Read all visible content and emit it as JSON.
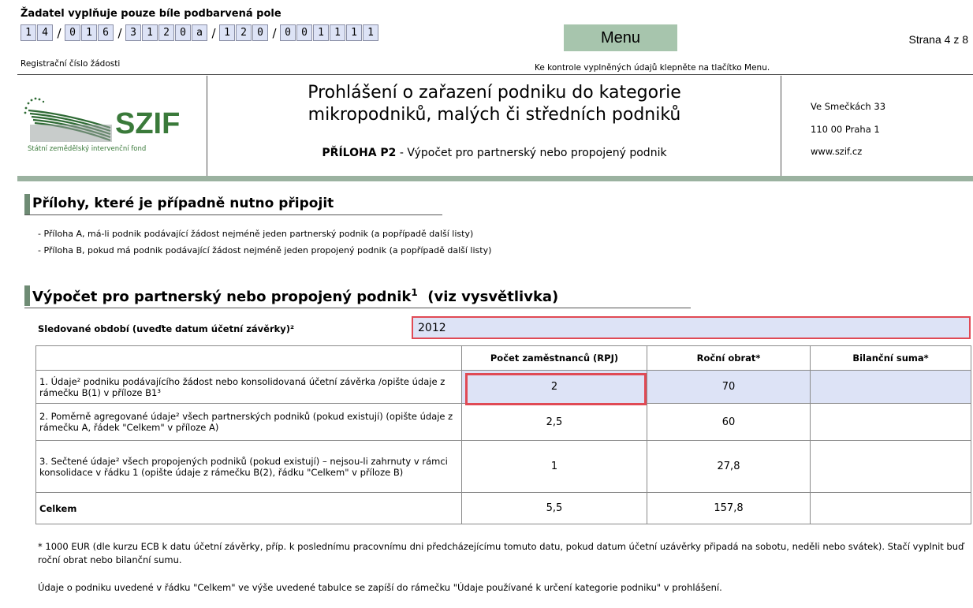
{
  "header": {
    "instruction": "Žadatel vyplňuje pouze bíle podbarvená pole",
    "reg_groups": [
      [
        "1",
        "4"
      ],
      [
        "0",
        "1",
        "6"
      ],
      [
        "3",
        "1",
        "2",
        "0",
        "a"
      ],
      [
        "1",
        "2",
        "0"
      ],
      [
        "0",
        "0",
        "1",
        "1",
        "1",
        "1"
      ]
    ],
    "reg_caption": "Registrační číslo žádosti",
    "menu_label": "Menu",
    "page_indicator": "Strana 4 z 8",
    "menu_hint": "Ke kontrole vyplněných údajů klepněte na tlačítko Menu."
  },
  "logo": {
    "name": "SZIF",
    "subtitle": "Státní zemědělský intervenční fond"
  },
  "title": {
    "line1": "Prohlášení o zařazení podniku do kategorie",
    "line2": "mikropodniků, malých či středních podniků",
    "annex_bold": "PŘÍLOHA P2",
    "annex_rest": " - Výpočet pro partnerský nebo propojený podnik"
  },
  "address": {
    "street": "Ve Smečkách 33",
    "city": "110 00 Praha 1",
    "web": "www.szif.cz"
  },
  "attachments": {
    "heading": "Přílohy, které je případně nutno připojit",
    "items": [
      "- Příloha A, má-li podnik podávající žádost nejméně jeden partnerský podnik (a popřípadě další listy)",
      "- Příloha B, pokud má podnik podávající žádost nejméně jeden propojený podnik (a popřípadě další listy)"
    ]
  },
  "calculation": {
    "heading": "Výpočet pro partnerský nebo propojený podnik",
    "heading_sup": "1",
    "heading_suffix": "(viz vysvětlivka)",
    "period_label": "Sledované období (uveďte datum účetní závěrky)²",
    "period_value": "2012",
    "columns": [
      "Počet zaměstnanců (RPJ)",
      "Roční obrat*",
      "Bilanční suma*"
    ],
    "rows": [
      {
        "label": "1. Údaje² podniku podávajícího žádost nebo konsolidovaná účetní závěrka /opište údaje z rámečku B(1) v příloze B1³",
        "employees": "2",
        "turnover": "70",
        "balance": ""
      },
      {
        "label": "2. Poměrně agregované údaje² všech partnerských podniků (pokud existují) (opište údaje z rámečku A, řádek \"Celkem\" v příloze A)",
        "employees": "2,5",
        "turnover": "60",
        "balance": ""
      },
      {
        "label": "3. Sečtené údaje² všech propojených podniků (pokud existují) – nejsou-li zahrnuty v rámci konsolidace v řádku 1 (opište údaje z rámečku B(2), řádku \"Celkem\" v příloze B)",
        "employees": "1",
        "turnover": "27,8",
        "balance": ""
      },
      {
        "label": "Celkem",
        "employees": "5,5",
        "turnover": "157,8",
        "balance": ""
      }
    ],
    "footnote": "* 1000 EUR (dle kurzu ECB k datu účetní závěrky, příp. k poslednímu pracovnímu dni předcházejícímu tomuto datu, pokud datum účetní uzávěrky připadá na sobotu, neděli nebo svátek). Stačí vyplnit buď roční obrat nebo bilanční sumu.",
    "note": "Údaje o podniku uvedené v řádku \"Celkem\" ve výše uvedené tabulce se zapíší do rámečku \"Údaje používané k určení kategorie podniku\" v prohlášení."
  },
  "colors": {
    "input_bg": "#dde3f6",
    "highlight_border": "#e04a55",
    "section_green": "#6e8b74",
    "menu_green": "#a7c5ad"
  }
}
